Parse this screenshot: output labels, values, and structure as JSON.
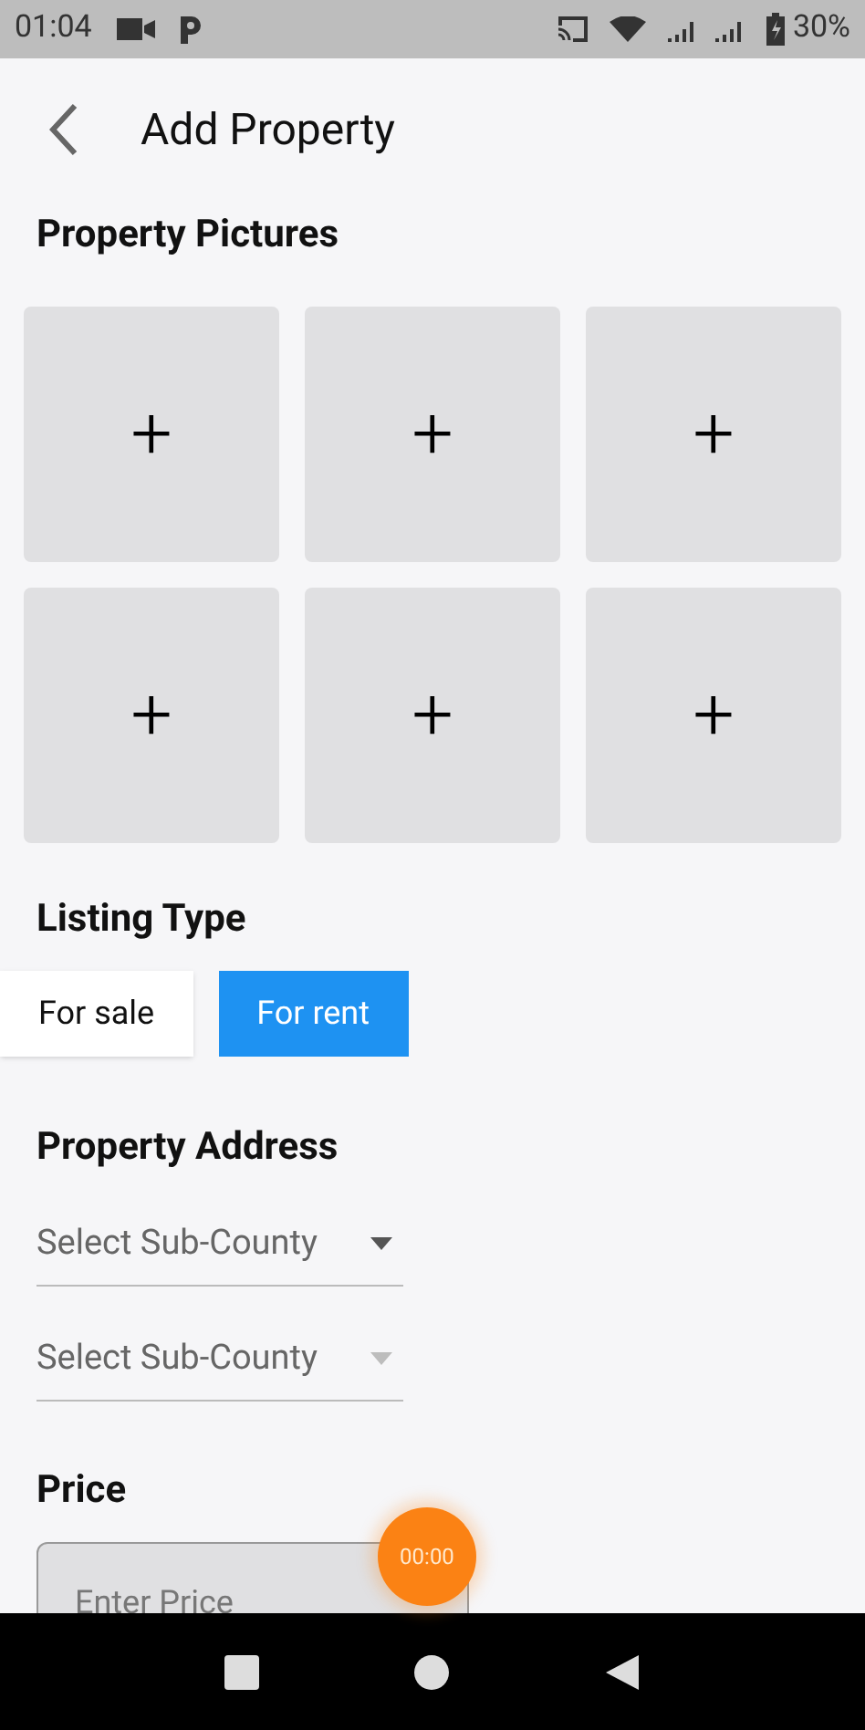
{
  "status_bar": {
    "time": "01:04",
    "battery": "30%"
  },
  "header": {
    "title": "Add Property"
  },
  "pictures": {
    "title": "Property Pictures",
    "slots": [
      {
        "icon": "+"
      },
      {
        "icon": "+"
      },
      {
        "icon": "+"
      },
      {
        "icon": "+"
      },
      {
        "icon": "+"
      },
      {
        "icon": "+"
      }
    ]
  },
  "listing_type": {
    "title": "Listing Type",
    "options": [
      {
        "label": "For sale",
        "selected": false
      },
      {
        "label": "For rent",
        "selected": true
      }
    ]
  },
  "address": {
    "title": "Property Address",
    "dropdowns": [
      {
        "placeholder": "Select Sub-County",
        "disabled": false
      },
      {
        "placeholder": "Select Sub-County",
        "disabled": true
      }
    ]
  },
  "price": {
    "title": "Price",
    "placeholder": "Enter Price"
  },
  "timer": {
    "label": "00:00"
  }
}
